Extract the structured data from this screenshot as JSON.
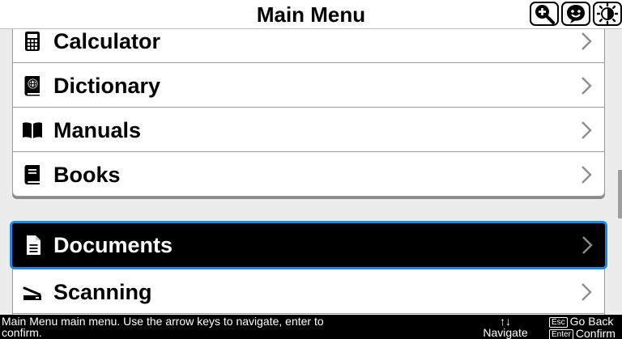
{
  "header": {
    "title": "Main Menu",
    "icons": [
      "zoom-in-icon",
      "smiley-icon",
      "contrast-icon"
    ]
  },
  "menu": {
    "group1": [
      {
        "label": "Calculator",
        "icon": "calculator-icon"
      },
      {
        "label": "Dictionary",
        "icon": "dictionary-icon"
      },
      {
        "label": "Manuals",
        "icon": "book-open-icon"
      },
      {
        "label": "Books",
        "icon": "book-icon"
      }
    ],
    "group2": [
      {
        "label": "Documents",
        "icon": "document-icon",
        "selected": true
      },
      {
        "label": "Scanning",
        "icon": "scanner-icon"
      }
    ]
  },
  "footer": {
    "message": "Main Menu main menu. Use the arrow keys to navigate, enter to confirm.",
    "navigate_keys": "↑↓",
    "navigate_label": "Navigate",
    "esc_key": "Esc",
    "back_label": "Go Back",
    "enter_key": "Enter",
    "confirm_label": "Confirm"
  },
  "colors": {
    "selection_border": "#1e88e5",
    "selected_bg": "#000000"
  }
}
